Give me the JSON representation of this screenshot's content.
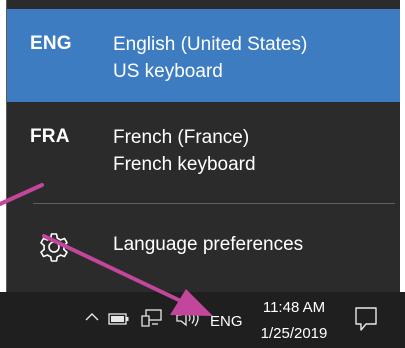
{
  "languages": [
    {
      "code": "ENG",
      "name": "English (United States)",
      "keyboard": "US keyboard"
    },
    {
      "code": "FRA",
      "name": "French (France)",
      "keyboard": "French keyboard"
    }
  ],
  "preferences": {
    "label": "Language preferences",
    "icon": "gear-icon"
  },
  "taskbar": {
    "input_indicator": "ENG",
    "time": "11:48 AM",
    "date": "1/25/2019",
    "icons": [
      "chevron-up-icon",
      "battery-icon",
      "network-icon",
      "volume-icon",
      "action-center-icon"
    ]
  },
  "colors": {
    "flyout_bg": "#2b2b2b",
    "selected_bg": "#3d7cc0",
    "taskbar_bg": "#1f1f1f",
    "annotation_arrow": "#c2469b"
  }
}
